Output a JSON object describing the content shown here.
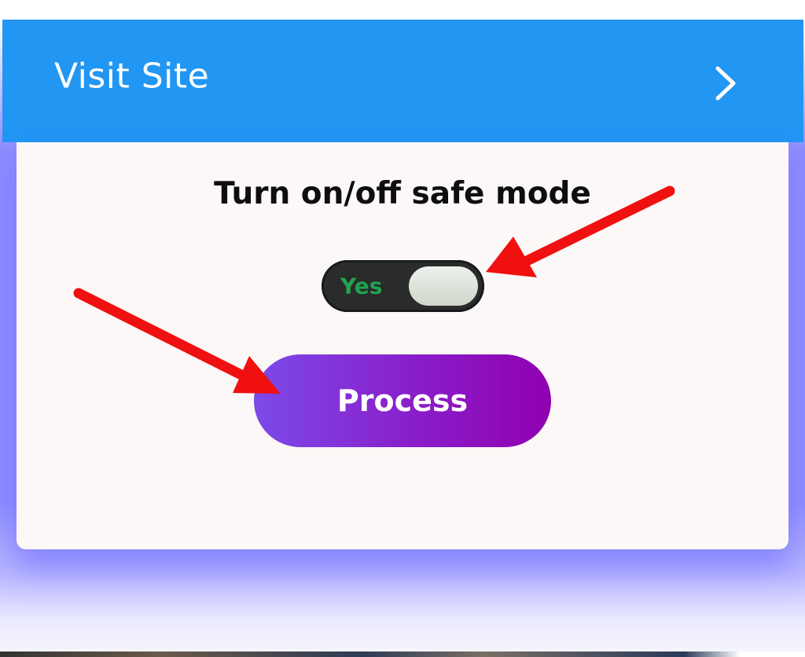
{
  "ad_bar": {
    "title": "Visit Site",
    "chevron_icon": "chevron-right-icon",
    "background_color": "#2196f3"
  },
  "card": {
    "heading": "Turn on/off safe mode",
    "toggle": {
      "label": "Yes",
      "state": "on",
      "label_color": "#1fa44f"
    },
    "process_button": {
      "label": "Process",
      "gradient_colors": [
        "#7b4ae8",
        "#9000b0"
      ]
    }
  },
  "annotations": {
    "arrow_color": "#f01010",
    "arrows": [
      "arrow-to-toggle",
      "arrow-to-process-button"
    ]
  }
}
